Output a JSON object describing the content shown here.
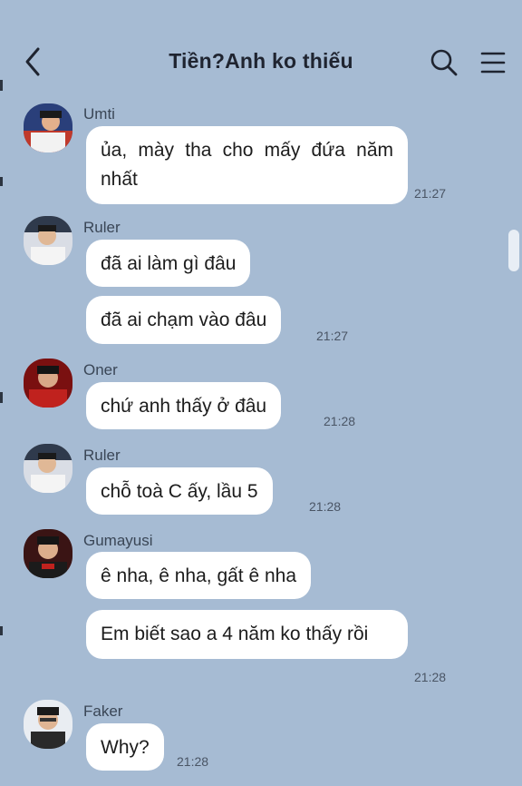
{
  "header": {
    "title": "Tiền?Anh ko thiếu",
    "icons": {
      "back": "chevron-left-icon",
      "search": "search-icon",
      "menu": "hamburger-menu-icon"
    }
  },
  "messages": [
    {
      "sender": "Umti",
      "bubbles": [
        "ủa, mày tha cho mấy đứa năm nhất"
      ],
      "time": "21:27"
    },
    {
      "sender": "Ruler",
      "bubbles": [
        "đã ai làm gì đâu",
        "đã ai chạm vào đâu"
      ],
      "time": "21:27"
    },
    {
      "sender": "Oner",
      "bubbles": [
        "chứ anh thấy ở đâu"
      ],
      "time": "21:28"
    },
    {
      "sender": "Ruler",
      "bubbles": [
        "chỗ toà C ấy, lầu 5"
      ],
      "time": "21:28"
    },
    {
      "sender": "Gumayusi",
      "bubbles": [
        "ê nha, ê nha, gất ê nha",
        "Em biết sao a 4 năm ko thấy rồi"
      ],
      "time": "21:28"
    },
    {
      "sender": "Faker",
      "bubbles": [
        "Why?"
      ],
      "time": "21:28"
    }
  ],
  "colors": {
    "background": "#a6bbd3",
    "bubble": "#ffffff",
    "text": "#1c1c1c",
    "name": "#3a4656"
  }
}
